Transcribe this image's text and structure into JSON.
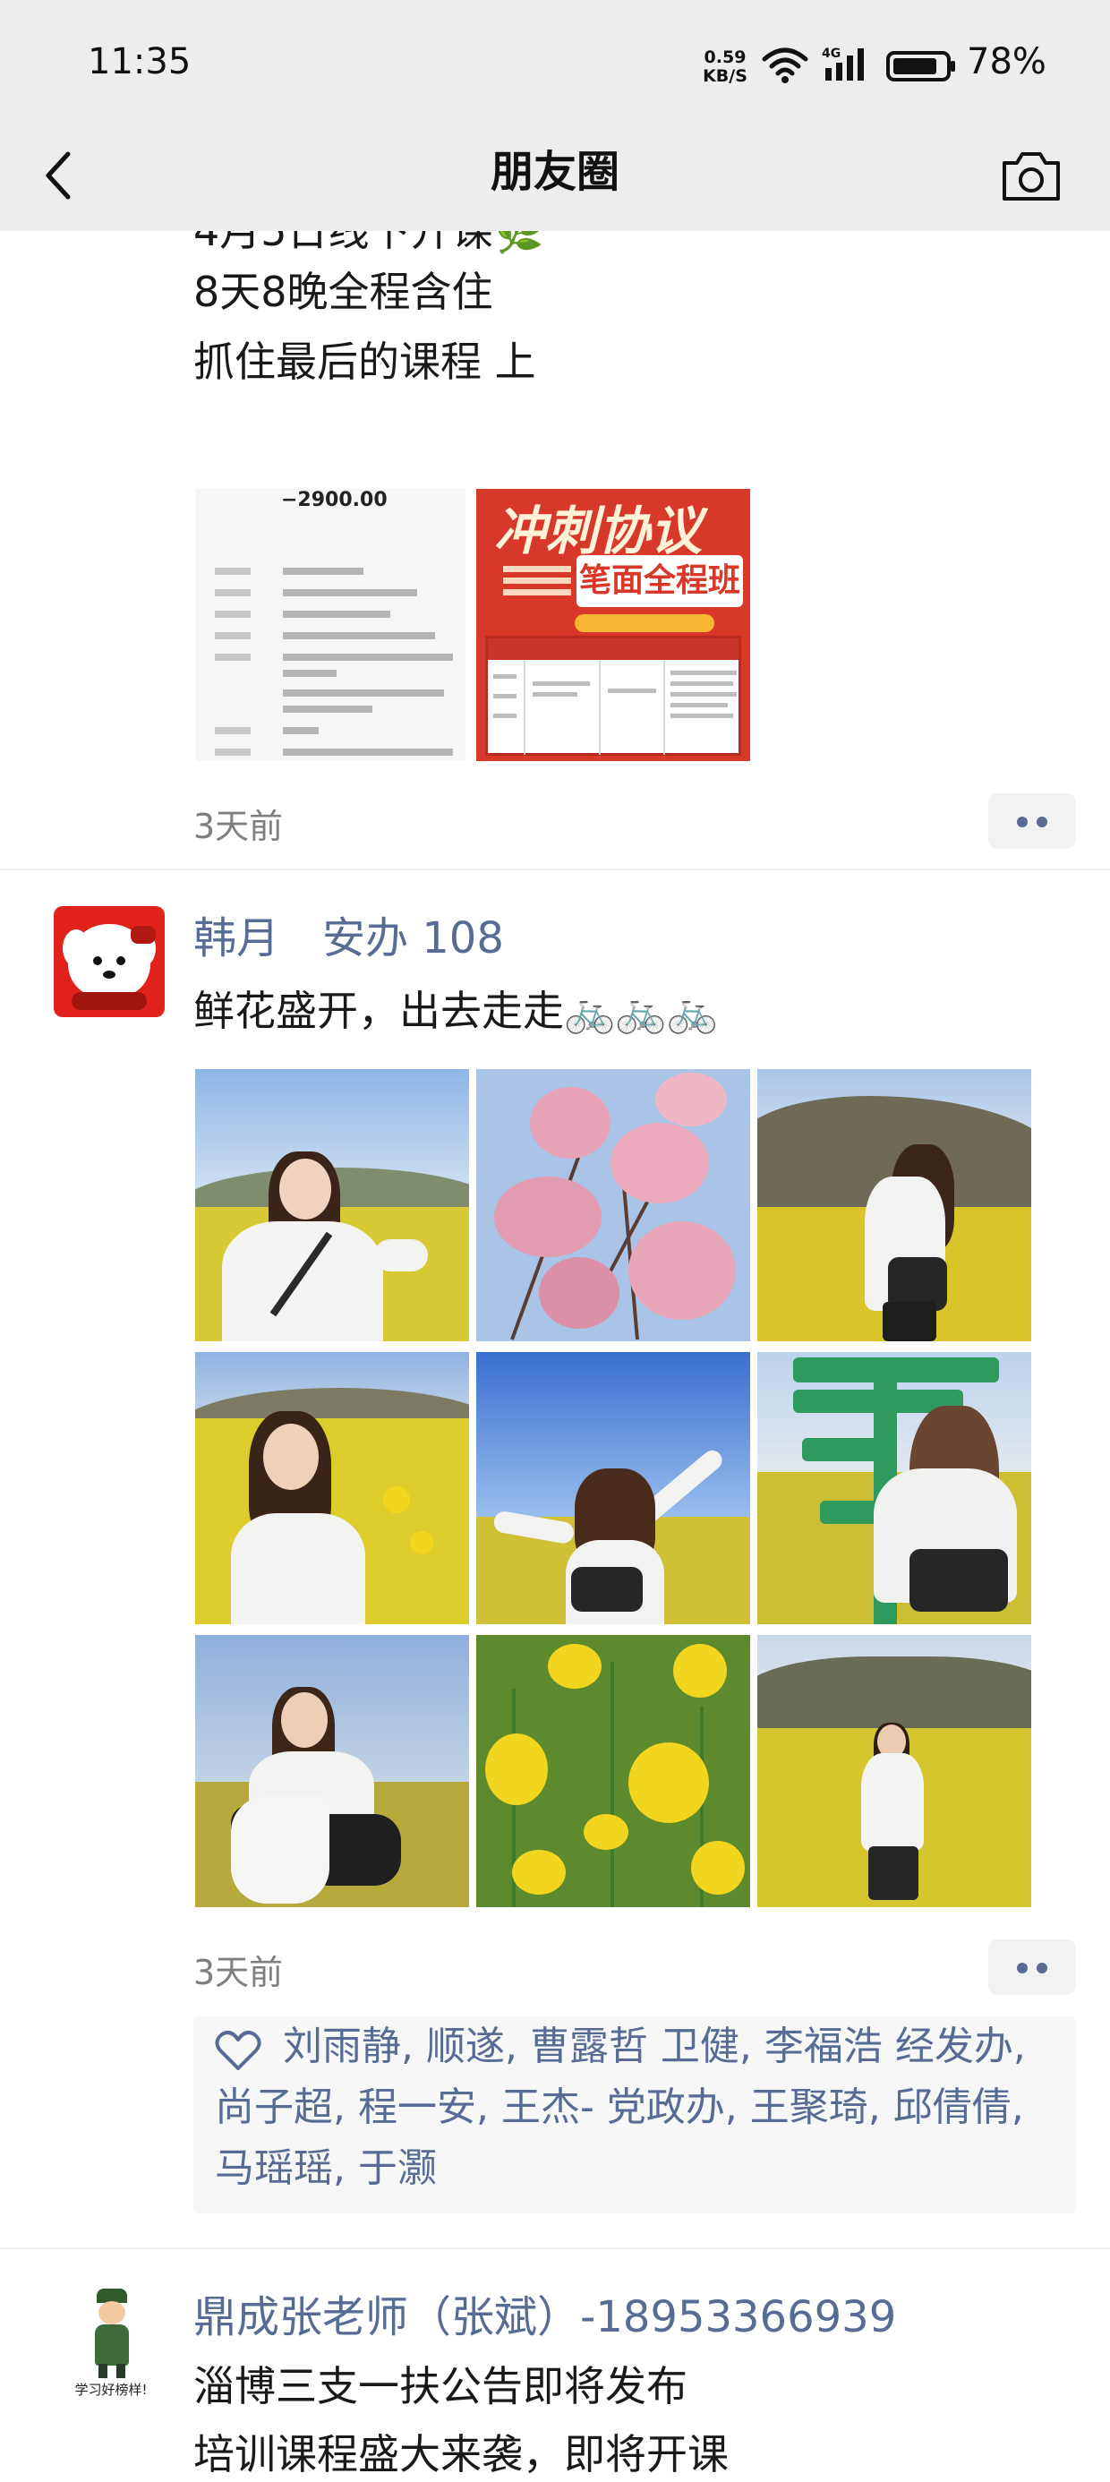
{
  "status_bar": {
    "time": "11:35",
    "net_speed_value": "0.59",
    "net_speed_unit": "KB/S",
    "network_type": "4G",
    "battery": "78%"
  },
  "nav": {
    "title": "朋友圈",
    "back_icon": "chevron-left-icon",
    "camera_icon": "camera-icon"
  },
  "post1": {
    "partial_line": "4月5日线下开课🌿",
    "lines": [
      "8天8晚全程含住",
      "抓住最后的课程 上"
    ],
    "images": {
      "receipt_amount": "−2900.00",
      "poster_title": "冲刺协议",
      "poster_banner": "笔面全程班"
    },
    "time": "3天前"
  },
  "post2": {
    "author": "韩月　安办 108",
    "text": "鲜花盛开，出去走走🚲🚲🚲",
    "time": "3天前",
    "likes": "刘雨静, 顺遂, 曹露哲  卫健, 李福浩  经发办, 尚子超, 程一安, 王杰-   党政办, 王聚琦, 邱倩倩, 马瑶瑶, 于灏"
  },
  "post3": {
    "author": "鼎成张老师（张斌）-18953366939",
    "avatar_text": "学习好榜样!",
    "lines": [
      "淄博三支一扶公告即将发布",
      "培训课程盛大来袭，即将开课"
    ]
  },
  "colors": {
    "link_blue": "#576b95",
    "nav_bg": "#ededed",
    "timestamp_gray": "#7f7f7f"
  }
}
